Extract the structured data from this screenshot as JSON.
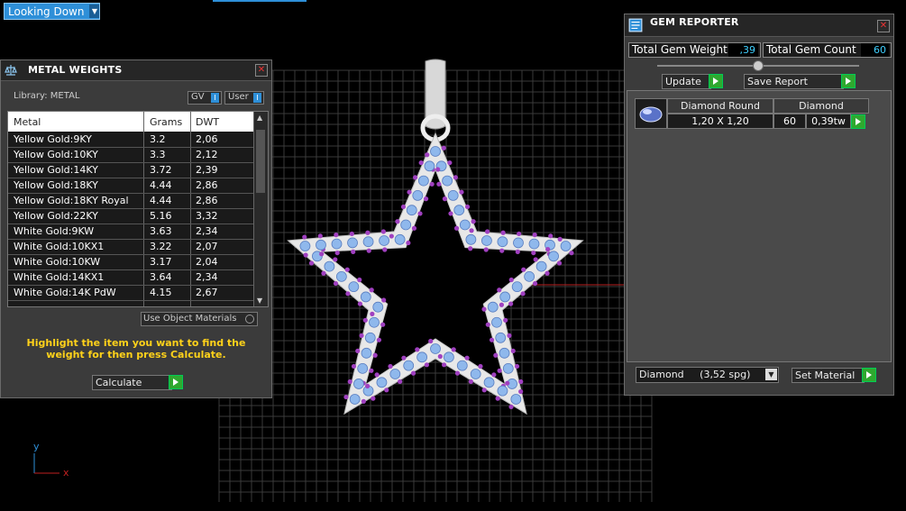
{
  "view": {
    "dropdown_label": "Looking Down"
  },
  "axes": {
    "y": "y",
    "x": "x"
  },
  "metal_panel": {
    "title": "METAL WEIGHTS",
    "library_label": "Library: METAL",
    "gv_label": "GV",
    "user_label": "User",
    "headers": {
      "metal": "Metal",
      "grams": "Grams",
      "dwt": "DWT"
    },
    "rows": [
      {
        "metal": "Yellow Gold:9KY",
        "grams": "3.2",
        "dwt": "2,06"
      },
      {
        "metal": "Yellow Gold:10KY",
        "grams": "3.3",
        "dwt": "2,12"
      },
      {
        "metal": "Yellow Gold:14KY",
        "grams": "3.72",
        "dwt": "2,39"
      },
      {
        "metal": "Yellow Gold:18KY",
        "grams": "4.44",
        "dwt": "2,86"
      },
      {
        "metal": "Yellow Gold:18KY Royal",
        "grams": "4.44",
        "dwt": "2,86"
      },
      {
        "metal": "Yellow Gold:22KY",
        "grams": "5.16",
        "dwt": "3,32"
      },
      {
        "metal": "White Gold:9KW",
        "grams": "3.63",
        "dwt": "2,34"
      },
      {
        "metal": "White Gold:10KX1",
        "grams": "3.22",
        "dwt": "2,07"
      },
      {
        "metal": "White Gold:10KW",
        "grams": "3.17",
        "dwt": "2,04"
      },
      {
        "metal": "White Gold:14KX1",
        "grams": "3.64",
        "dwt": "2,34"
      },
      {
        "metal": "White Gold:14K PdW",
        "grams": "4.15",
        "dwt": "2,67"
      }
    ],
    "use_object_materials": "Use Object Materials",
    "instruction": "Highlight the item you want to find the weight for then press Calculate.",
    "calculate_label": "Calculate"
  },
  "gem_panel": {
    "title": "GEM REPORTER",
    "total_weight_label": "Total Gem Weight",
    "total_weight_value": ",39",
    "total_count_label": "Total Gem Count",
    "total_count_value": "60",
    "update_label": "Update",
    "save_report_label": "Save Report",
    "gem_row": {
      "shape": "Diamond Round",
      "material": "Diamond",
      "size": "1,20 X 1,20",
      "count": "60",
      "weight": "0,39tw"
    },
    "material_select": "Diamond     (3,52 spg)",
    "set_material_label": "Set Material"
  },
  "colors": {
    "accent": "#2e8fd8",
    "green_button": "#2fa82f",
    "instruction_text": "#ffd21a",
    "gem_stone": "#8fb8ec",
    "prong": "#a040c0",
    "metal": "#e8e8e8"
  }
}
